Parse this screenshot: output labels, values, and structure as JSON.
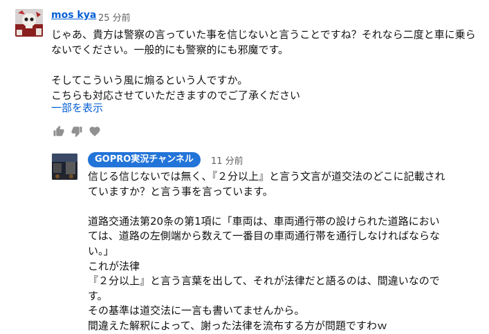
{
  "comment": {
    "author": "mos kya",
    "time": "25 分前",
    "text": "じゃあ、貴方は警察の言っていた事を信じないと言うことですね？それなら二度と車に乗らないでください。一般的にも警察的にも邪魔です。\n\nそしてこういう風に煽るという人ですか。\nこちらも対応させていただきますのでご了承ください",
    "show_more": "一部を表示",
    "actions": [
      "thumbs-up-icon",
      "thumbs-down-icon",
      "heart-icon"
    ]
  },
  "reply": {
    "author": "GOPRO実況チャンネル",
    "time": "11 分前",
    "text": "信じる信じないでは無く、『２分以上』と言う文言が道交法のどこに記載されていますか？と言う事を言っています。\n\n道路交通法第20条の第1項に「車両は、車両通行帯の設けられた道路においては、道路の左側端から数えて一番目の車両通行帯を通行しなければならない。」\nこれが法律\n『２分以上』と言う言葉を出して、それが法律だと語るのは、間違いなのです。\nその基準は道交法に一言も書いてませんから。\n間違えた解釈によって、謝った法律を流布する方が問題ですわｗ",
    "badge_color": "#2274d8"
  },
  "colors": {
    "link": "#065fd4",
    "meta": "#606060",
    "icon": "#909090"
  }
}
